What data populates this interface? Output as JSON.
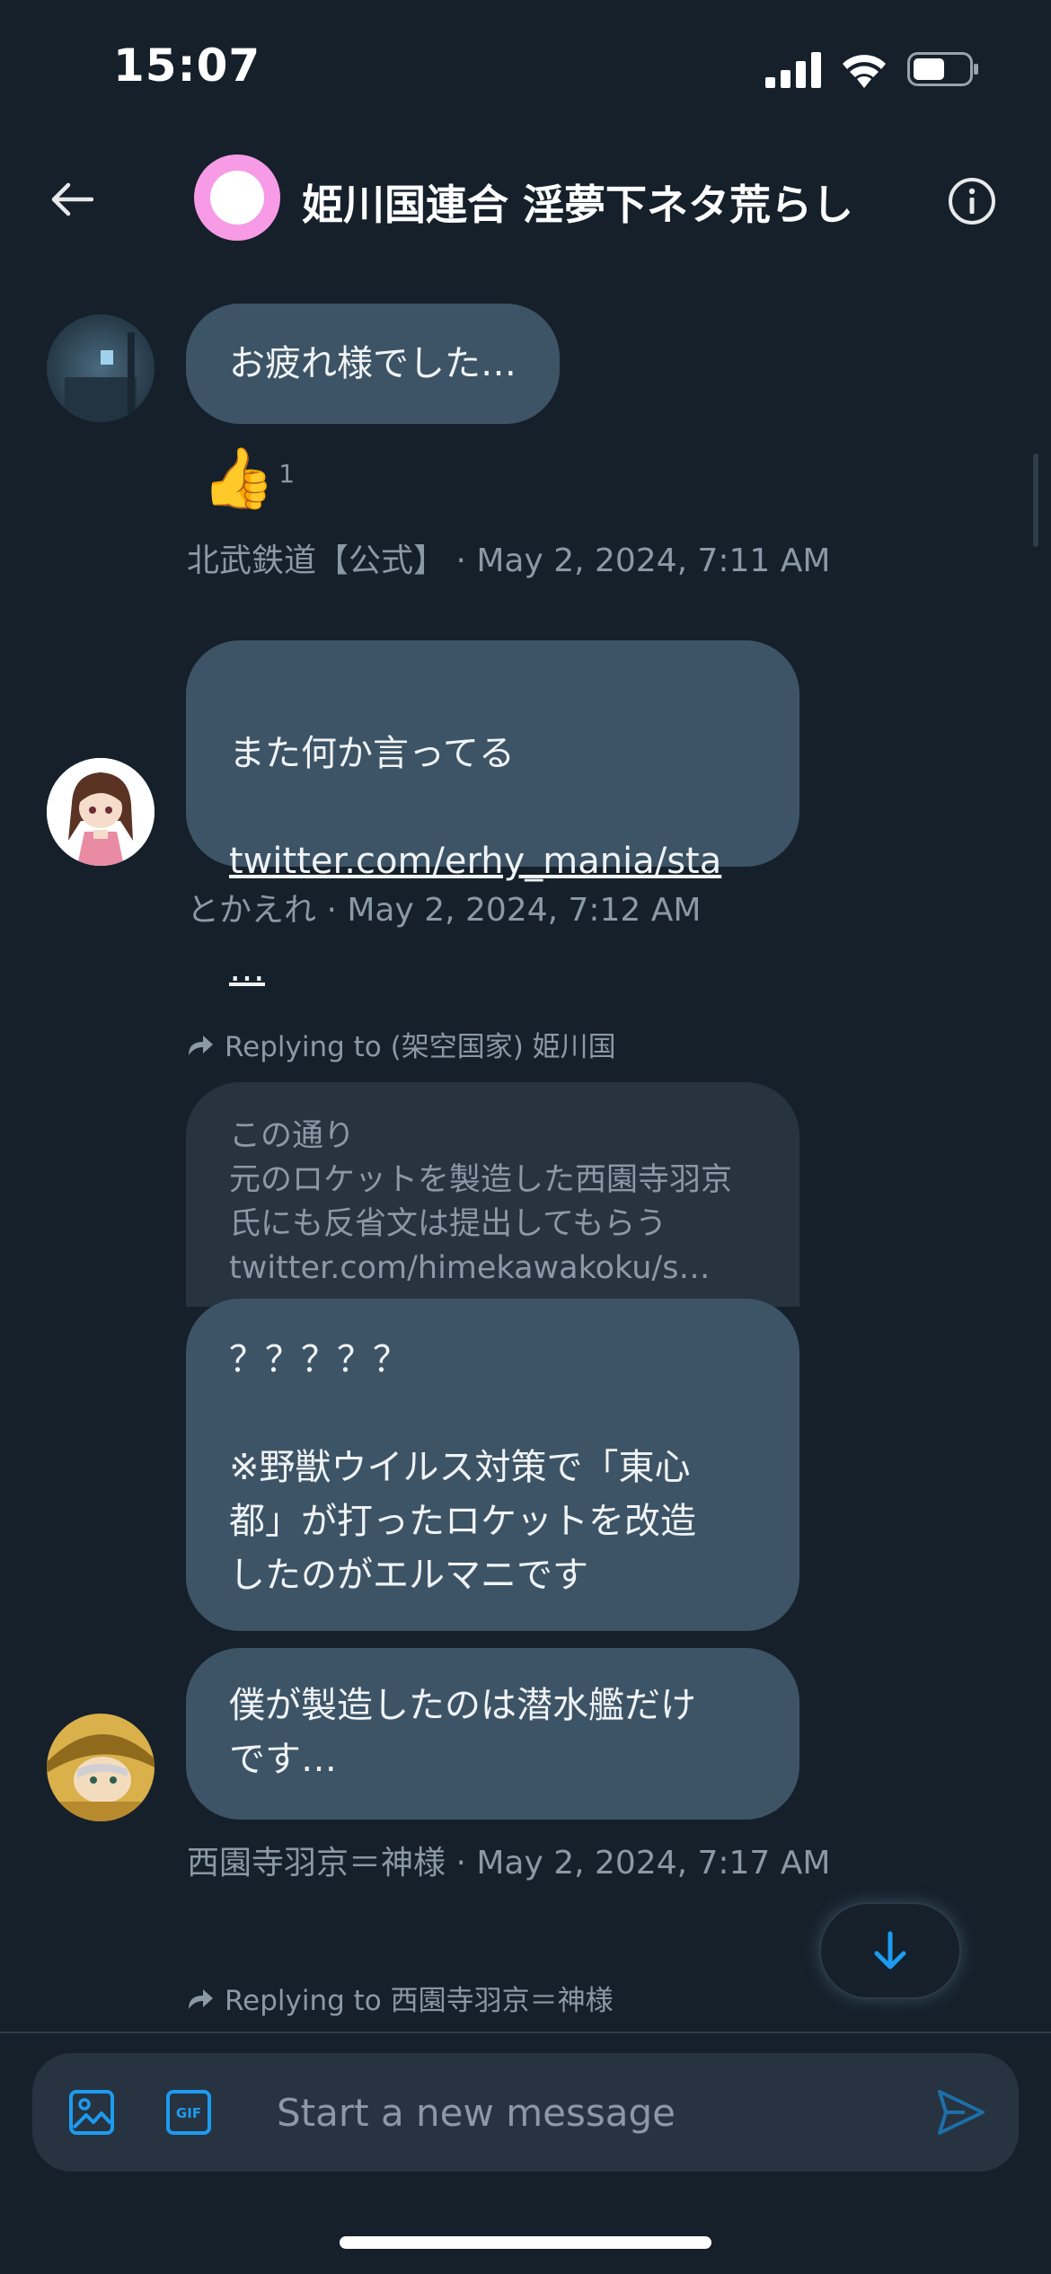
{
  "status_bar": {
    "time": "15:07"
  },
  "header": {
    "title": "姫川国連合 淫夢下ネタ荒らし"
  },
  "messages": [
    {
      "text": "お疲れ様でした…",
      "reaction": {
        "emoji": "👍",
        "count": "1"
      },
      "meta": "北武鉄道【公式】 · May 2, 2024, 7:11 AM"
    },
    {
      "text_line1": "また何か言ってる",
      "link_line1": "twitter.com/erhy_mania/sta",
      "link_line2": "…",
      "meta": "とかえれ · May 2, 2024, 7:12 AM"
    },
    {
      "reply_to": "Replying to (架空国家) 姫川国",
      "quoted": "この通り\n元のロケットを製造した西園寺羽京\n氏にも反省文は提出してもらう\ntwitter.com/himekawakoku/s…",
      "text": "？？？？？\n\n※野獣ウイルス対策で「東心\n都」が打ったロケットを改造\nしたのがエルマニです"
    },
    {
      "text": "僕が製造したのは潜水艦だけ\nです…",
      "meta": "西園寺羽京＝神様 · May 2, 2024, 7:17 AM"
    },
    {
      "reply_to": "Replying to 西園寺羽京＝神様"
    }
  ],
  "composer": {
    "placeholder": "Start a new message"
  },
  "icons": {
    "back": "arrow-left-icon",
    "info": "info-icon",
    "media": "image-icon",
    "gif": "gif-icon",
    "send": "send-icon",
    "scroll_down": "arrow-down-icon",
    "reply": "reply-arrow-icon"
  },
  "colors": {
    "background": "#15202b",
    "bubble": "#3d5466",
    "quoted_bubble": "#283340",
    "accent": "#1d9bf0",
    "muted_text": "#8b98a5",
    "header_avatar": "#f79be6"
  }
}
